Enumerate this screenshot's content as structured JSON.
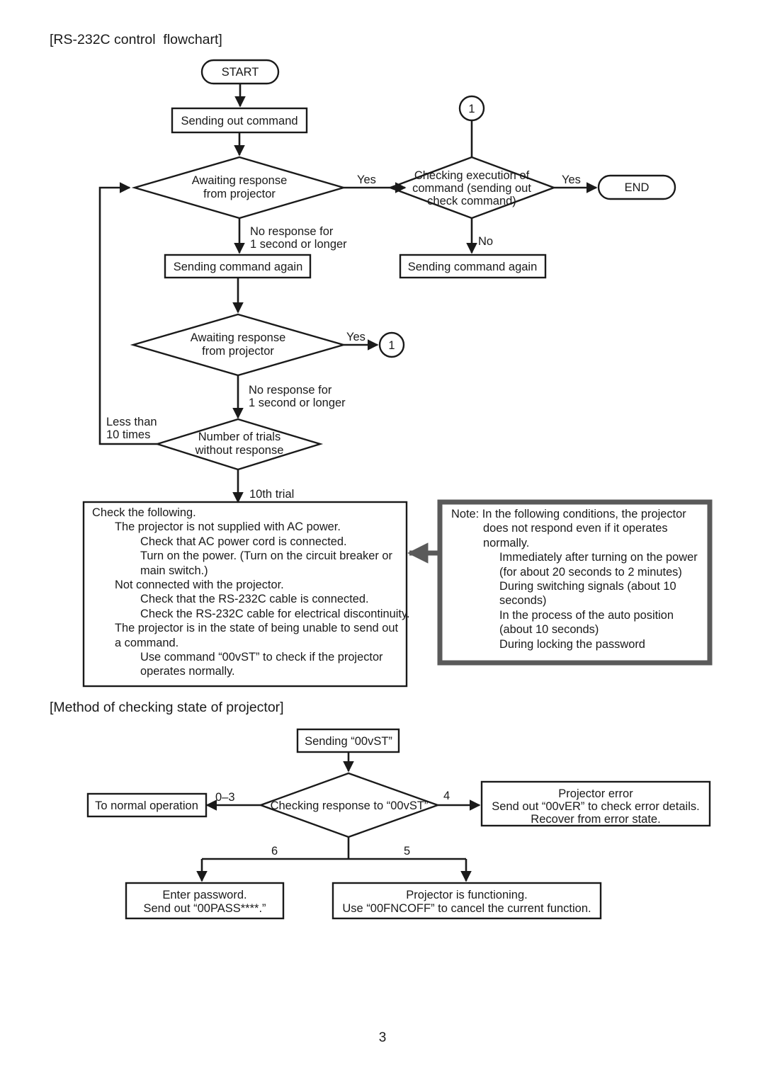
{
  "document": {
    "page_number": "3",
    "section1_heading": "[RS-232C control  flowchart]",
    "section2_heading": "[Method of checking state of projector]"
  },
  "flowchart1": {
    "nodes": {
      "start": "START",
      "end": "END",
      "sending_out_command": "Sending out command",
      "awaiting_response_1_line1": "Awaiting response",
      "awaiting_response_1_line2": "from projector",
      "awaiting_response_2_line1": "Awaiting response",
      "awaiting_response_2_line2": "from projector",
      "checking_execution_line1": "Checking execution of",
      "checking_execution_line2": "command (sending out",
      "checking_execution_line3": "check command)",
      "sending_again_left": "Sending command again",
      "sending_again_right": "Sending command again",
      "number_of_trials_line1": "Number of trials",
      "number_of_trials_line2": "without response",
      "connector_top": "1",
      "connector_bottom": "1"
    },
    "edge_labels": {
      "yes_1": "Yes",
      "yes_2": "Yes",
      "yes_3": "Yes",
      "no_1": "No",
      "no_response_1_line1": "No response for",
      "no_response_1_line2": "1 second or longer",
      "no_response_2_line1": "No response for",
      "no_response_2_line2": "1 second or longer",
      "less_than_line1": "Less than",
      "less_than_line2": "10 times",
      "tenth_trial": "10th trial"
    },
    "check_box": {
      "lines": [
        {
          "indent": 0,
          "text": "Check the following."
        },
        {
          "indent": 1,
          "text": "The projector is not supplied with AC power."
        },
        {
          "indent": 2,
          "text": "Check that AC power cord is connected."
        },
        {
          "indent": 2,
          "text": "Turn on the power. (Turn on the circuit breaker or"
        },
        {
          "indent": 2,
          "text": "main switch.)"
        },
        {
          "indent": 1,
          "text": "Not connected with the projector."
        },
        {
          "indent": 2,
          "text": "Check that the RS-232C cable is connected."
        },
        {
          "indent": 2,
          "text": "Check the RS-232C cable for electrical discontinuity."
        },
        {
          "indent": 1,
          "text": "The projector is in the state of being unable to send out"
        },
        {
          "indent": 1,
          "text": "a command."
        },
        {
          "indent": 2,
          "text": "Use command “00vST” to check if the projector"
        },
        {
          "indent": 2,
          "text": "operates normally."
        }
      ]
    },
    "note_box": {
      "lines": [
        {
          "indent": 0,
          "text": "Note: In the following conditions, the projector"
        },
        {
          "indent": 1,
          "text": "does not respond even if it operates"
        },
        {
          "indent": 1,
          "text": "normally."
        },
        {
          "indent": 2,
          "text": "Immediately after turning on the power"
        },
        {
          "indent": 2,
          "text": "(for about 20 seconds to 2 minutes)"
        },
        {
          "indent": 2,
          "text": "During switching signals (about 10"
        },
        {
          "indent": 2,
          "text": "seconds)"
        },
        {
          "indent": 2,
          "text": "In the process of the auto position"
        },
        {
          "indent": 2,
          "text": "(about 10 seconds)"
        },
        {
          "indent": 2,
          "text": "During locking the password"
        }
      ]
    }
  },
  "flowchart2": {
    "nodes": {
      "sending_00vst": "Sending “00vST”",
      "checking_response": "Checking response to “00vST”",
      "to_normal_operation": "To normal operation",
      "projector_error_line1": "Projector error",
      "projector_error_line2": "Send out “00vER” to check error details.",
      "projector_error_line3": "Recover from error state.",
      "enter_password_line1": "Enter password.",
      "enter_password_line2": "Send out “00PASS****.”",
      "functioning_line1": "Projector is functioning.",
      "functioning_line2": "Use “00FNCOFF” to cancel the current function."
    },
    "edge_labels": {
      "code_0_3": "0–3",
      "code_4": "4",
      "code_5": "5",
      "code_6": "6"
    }
  },
  "colors": {
    "ink": "#1a1a1a",
    "note_border": "#5a5a5a",
    "paper": "#ffffff"
  }
}
